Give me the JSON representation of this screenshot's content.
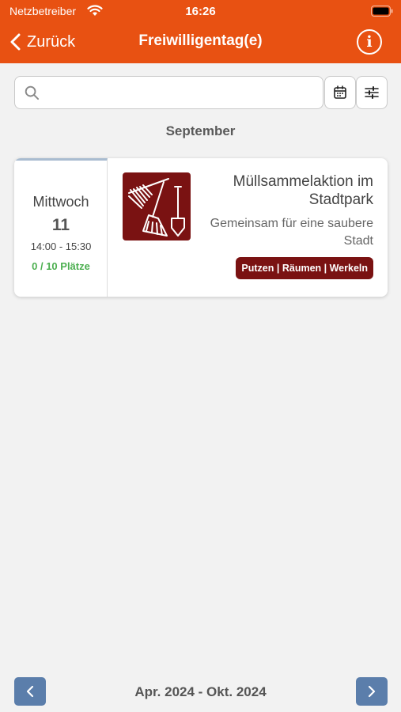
{
  "status_bar": {
    "carrier": "Netzbetreiber",
    "time": "16:26"
  },
  "nav": {
    "back_label": "Zurück",
    "title": "Freiwilligentag(e)"
  },
  "search": {
    "value": "",
    "placeholder": ""
  },
  "list": {
    "month": "September"
  },
  "event": {
    "weekday": "Mittwoch",
    "day": "11",
    "time": "14:00 - 15:30",
    "places": "0 / 10 Plätze",
    "title": "Müllsammelaktion im Stadtpark",
    "subtitle": "Gemeinsam für eine saubere Stadt",
    "tag": "Putzen | Räumen | Werkeln"
  },
  "footer": {
    "period": "Apr. 2024 - Okt. 2024"
  },
  "colors": {
    "header": "#e85112",
    "accent_dark_red": "#7a1212",
    "places_green": "#4caf50",
    "pager_blue": "#5b7eab"
  }
}
